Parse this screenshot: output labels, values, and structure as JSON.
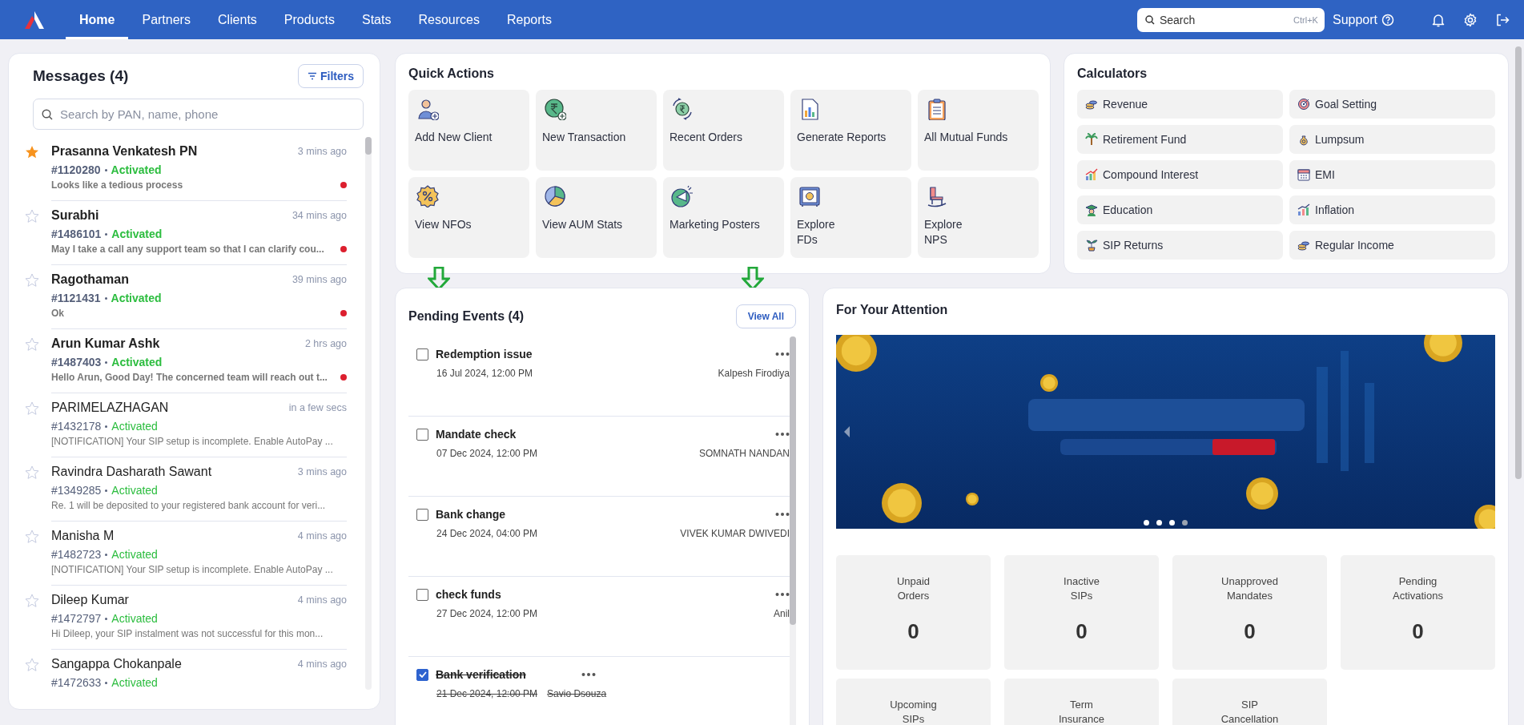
{
  "nav": {
    "items": [
      {
        "label": "Home",
        "selected": true
      },
      {
        "label": "Partners",
        "selected": false
      },
      {
        "label": "Clients",
        "selected": false
      },
      {
        "label": "Products",
        "selected": false
      },
      {
        "label": "Stats",
        "selected": false
      },
      {
        "label": "Resources",
        "selected": false
      },
      {
        "label": "Reports",
        "selected": false
      }
    ],
    "search": {
      "placeholder": "Search",
      "shortcut": "Ctrl+K"
    },
    "support": "Support"
  },
  "messages": {
    "title": "Messages (4)",
    "filters": "Filters",
    "search_placeholder": "Search by PAN, name, phone",
    "items": [
      {
        "name": "Prasanna Venkatesh PN",
        "time": "3 mins ago",
        "id": "#1120280",
        "status": "Activated",
        "preview": "Looks like a tedious process",
        "starred": true,
        "unread": true
      },
      {
        "name": "Surabhi",
        "time": "34 mins ago",
        "id": "#1486101",
        "status": "Activated",
        "preview": "May I take a call any support team so that I can clarify cou...",
        "starred": false,
        "unread": true
      },
      {
        "name": "Ragothaman",
        "time": "39 mins ago",
        "id": "#1121431",
        "status": "Activated",
        "preview": "Ok",
        "starred": false,
        "unread": true
      },
      {
        "name": "Arun Kumar Ashk",
        "time": "2 hrs ago",
        "id": "#1487403",
        "status": "Activated",
        "preview": "Hello Arun, Good Day! The concerned team will reach out t...",
        "starred": false,
        "unread": true
      },
      {
        "name": "PARIMELAZHAGAN",
        "time": "in a few secs",
        "id": "#1432178",
        "status": "Activated",
        "preview": "[NOTIFICATION] Your SIP setup is incomplete. Enable AutoPay ...",
        "starred": false,
        "unread": false
      },
      {
        "name": "Ravindra Dasharath Sawant",
        "time": "3 mins ago",
        "id": "#1349285",
        "status": "Activated",
        "preview": "Re. 1 will be deposited to your registered bank account for veri...",
        "starred": false,
        "unread": false
      },
      {
        "name": "Manisha M",
        "time": "4 mins ago",
        "id": "#1482723",
        "status": "Activated",
        "preview": "[NOTIFICATION] Your SIP setup is incomplete. Enable AutoPay ...",
        "starred": false,
        "unread": false
      },
      {
        "name": "Dileep Kumar",
        "time": "4 mins ago",
        "id": "#1472797",
        "status": "Activated",
        "preview": "Hi Dileep, your SIP instalment was not successful for this mon...",
        "starred": false,
        "unread": false
      },
      {
        "name": "Sangappa Chokanpale",
        "time": "4 mins ago",
        "id": "#1472633",
        "status": "Activated",
        "starred": false,
        "unread": false
      }
    ]
  },
  "quick_actions": {
    "title": "Quick Actions",
    "items": [
      {
        "label": "Add New Client"
      },
      {
        "label": "New Transaction"
      },
      {
        "label": "Recent Orders"
      },
      {
        "label": "Generate Reports"
      },
      {
        "label": "All Mutual Funds"
      },
      {
        "label": "View NFOs"
      },
      {
        "label": "View AUM Stats"
      },
      {
        "label": "Marketing Posters"
      },
      {
        "label": "Explore\nFDs"
      },
      {
        "label": "Explore\nNPS"
      }
    ]
  },
  "calculators": {
    "title": "Calculators",
    "items": [
      {
        "label": "Revenue"
      },
      {
        "label": "Goal Setting"
      },
      {
        "label": "Retirement Fund"
      },
      {
        "label": "Lumpsum"
      },
      {
        "label": "Compound Interest"
      },
      {
        "label": "EMI"
      },
      {
        "label": "Education"
      },
      {
        "label": "Inflation"
      },
      {
        "label": "SIP Returns"
      },
      {
        "label": "Regular Income"
      }
    ]
  },
  "pending_events": {
    "title": "Pending Events (4)",
    "view_all": "View All",
    "items": [
      {
        "title": "Redemption issue",
        "date": "16 Jul 2024, 12:00 PM",
        "assignee": "Kalpesh Firodiya",
        "done": false
      },
      {
        "title": "Mandate check",
        "date": "07 Dec 2024, 12:00 PM",
        "assignee": "SOMNATH NANDAN",
        "done": false
      },
      {
        "title": "Bank change",
        "date": "24 Dec 2024, 04:00 PM",
        "assignee": "VIVEK KUMAR DWIVEDI",
        "done": false
      },
      {
        "title": "check funds",
        "date": "27 Dec 2024, 12:00 PM",
        "assignee": "Anil",
        "done": false
      },
      {
        "title": "Bank verification",
        "date": "21 Dec 2024, 12:00 PM",
        "assignee": "Savio Dsouza",
        "done": true
      }
    ]
  },
  "attention": {
    "title": "For Your Attention",
    "carousel": {
      "kind": "picture",
      "dots": [
        {
          "selected": false
        },
        {
          "selected": false
        },
        {
          "selected": false
        },
        {
          "selected": true
        }
      ]
    },
    "stats": [
      {
        "label": "Unpaid\nOrders",
        "value": "0"
      },
      {
        "label": "Inactive\nSIPs",
        "value": "0"
      },
      {
        "label": "Unapproved\nMandates",
        "value": "0"
      },
      {
        "label": "Pending\nActivations",
        "value": "0"
      },
      {
        "label": "Upcoming\nSIPs"
      },
      {
        "label": "Term\nInsurance"
      },
      {
        "label": "SIP\nCancellation"
      }
    ]
  }
}
